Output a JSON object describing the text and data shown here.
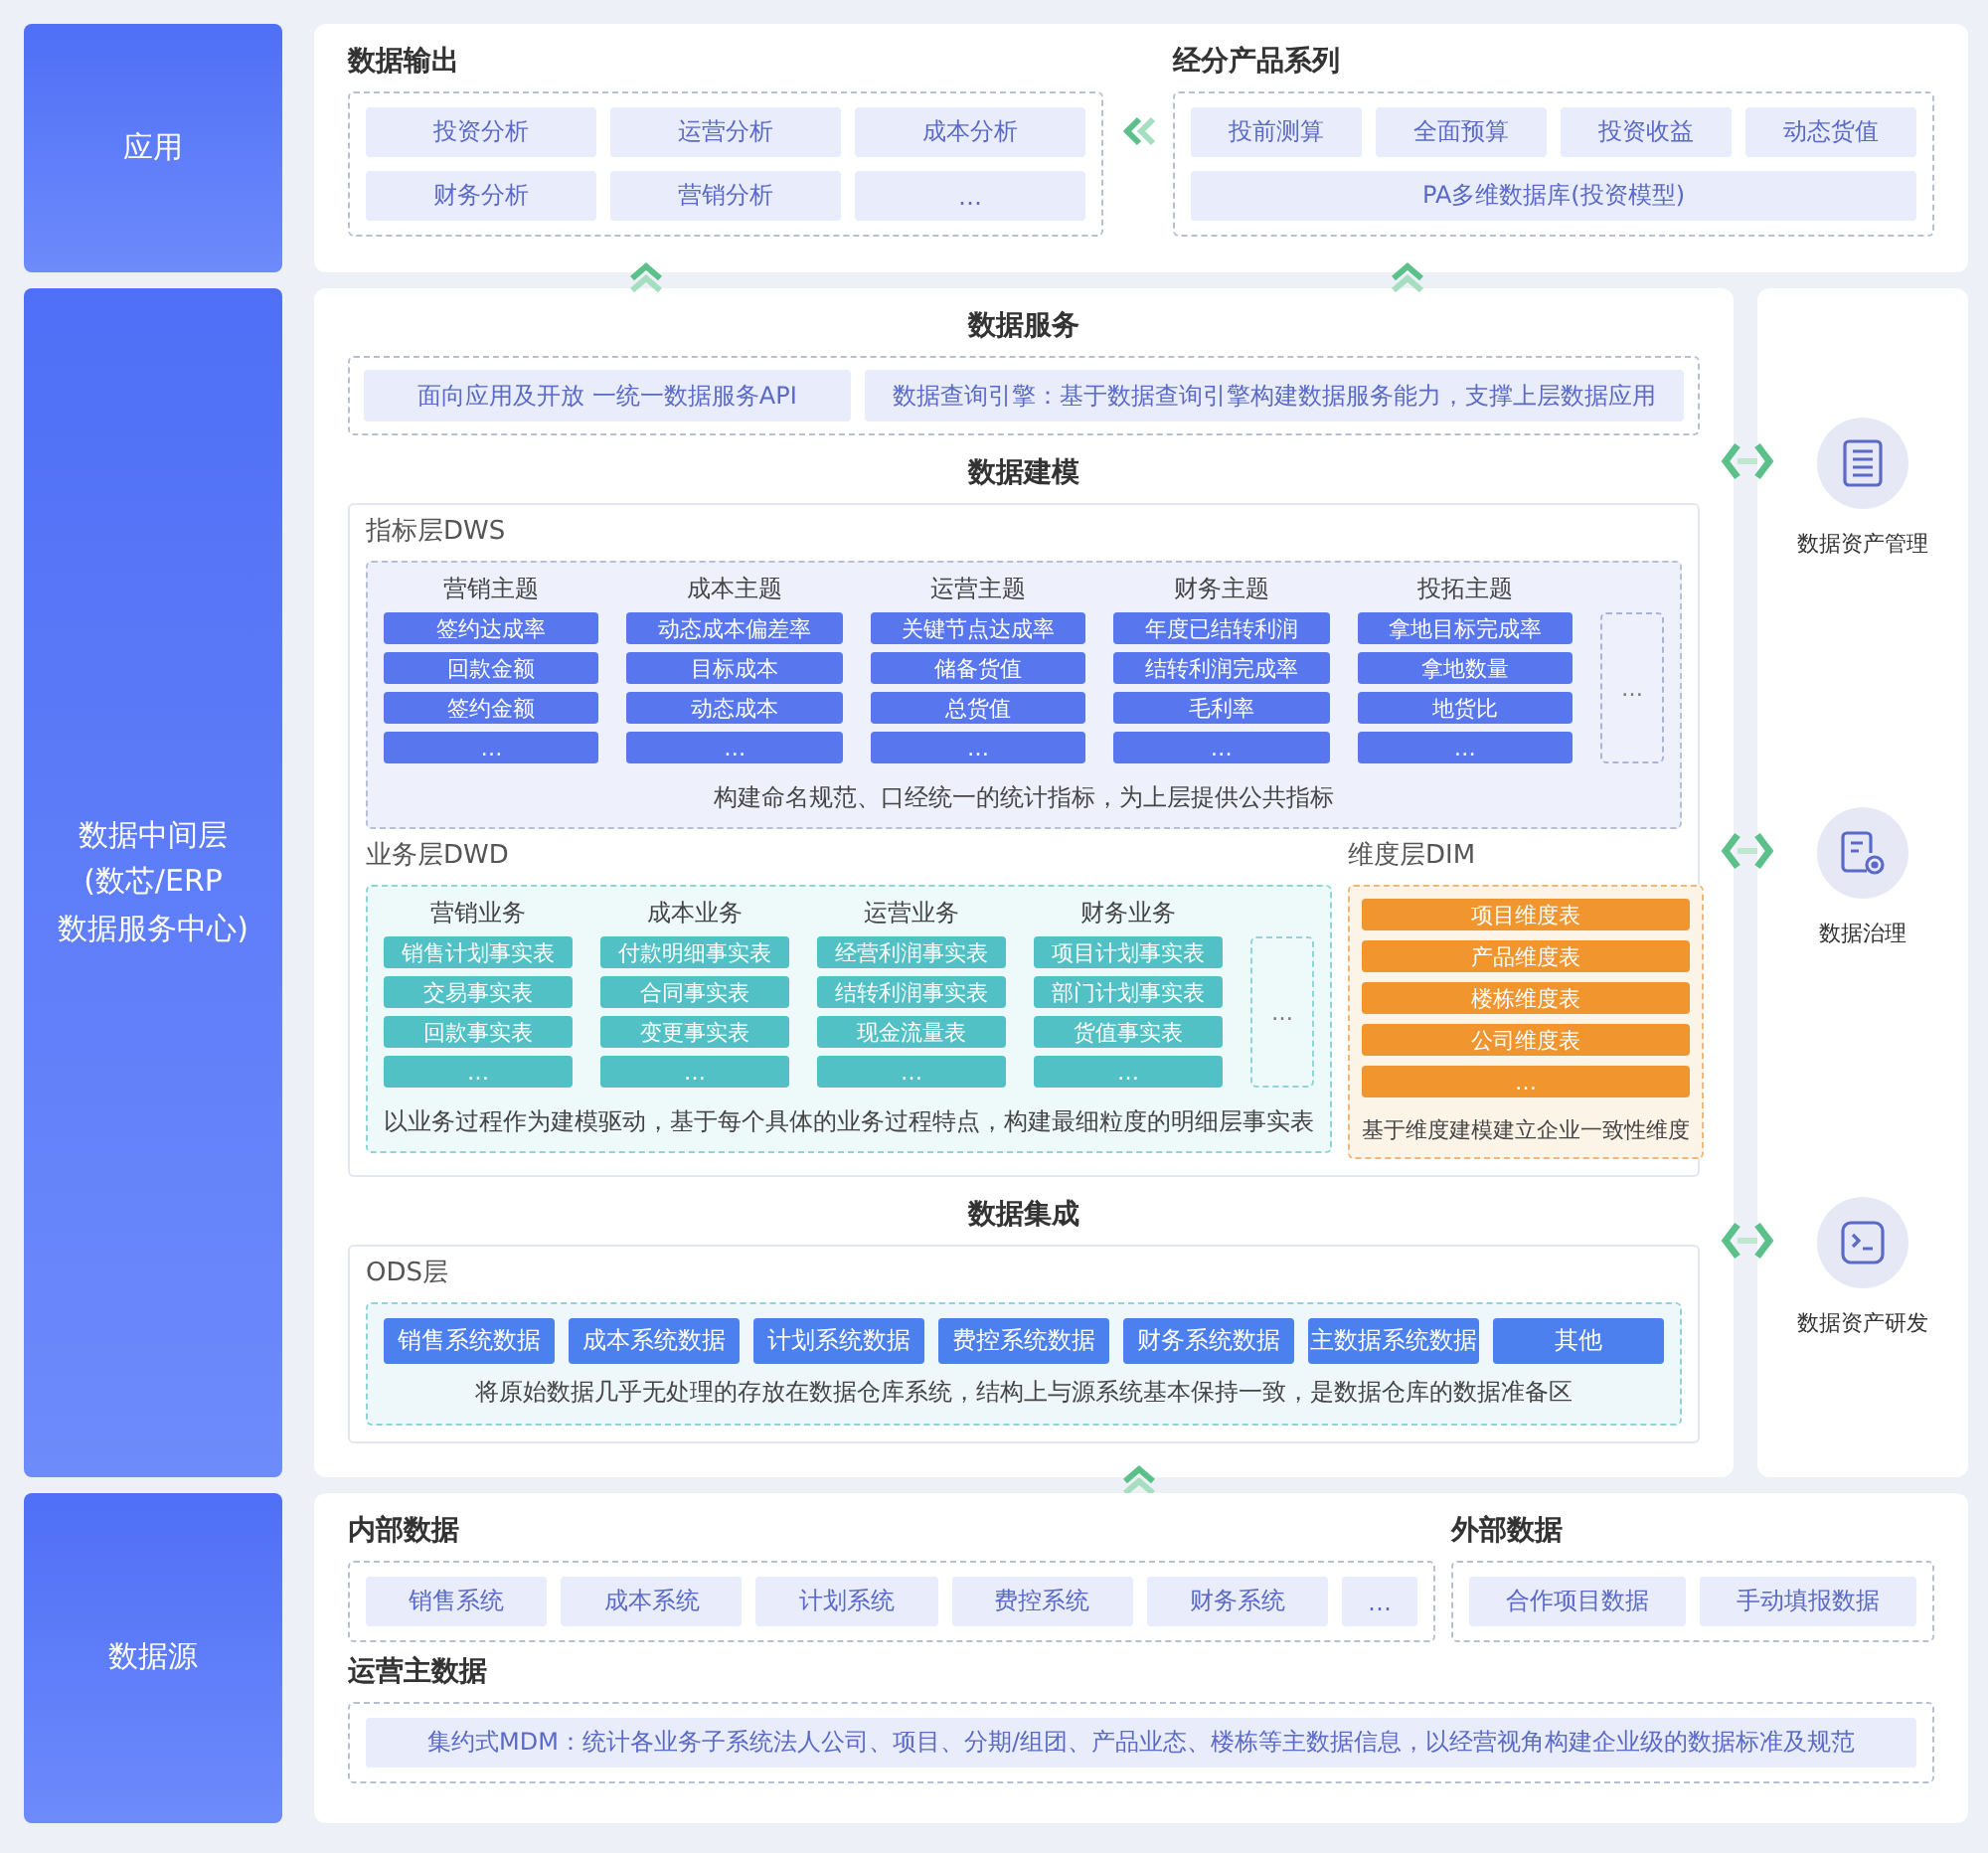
{
  "layers": [
    {
      "lines": [
        "应用"
      ]
    },
    {
      "lines": [
        "数据中间层",
        "(数芯/ERP",
        "数据服务中心)"
      ]
    },
    {
      "lines": [
        "数据源"
      ]
    }
  ],
  "application": {
    "data_output": {
      "title": "数据输出",
      "items": [
        "投资分析",
        "运营分析",
        "成本分析",
        "财务分析",
        "营销分析",
        "…"
      ]
    },
    "products": {
      "title": "经分产品系列",
      "items": [
        "投前测算",
        "全面预算",
        "投资收益",
        "动态货值"
      ],
      "base": "PA多维数据库(投资模型)"
    }
  },
  "middle": {
    "data_service": {
      "title": "数据服务",
      "items": [
        "面向应用及开放 一统一数据服务API",
        "数据查询引擎：基于数据查询引擎构建数据服务能力，支撑上层数据应用"
      ]
    },
    "modeling": {
      "title": "数据建模",
      "dws": {
        "title": "指标层DWS",
        "more": "…",
        "caption": "构建命名规范、口经统一的统计指标，为上层提供公共指标",
        "columns": [
          {
            "title": "营销主题",
            "items": [
              "签约达成率",
              "回款金额",
              "签约金额",
              "…"
            ]
          },
          {
            "title": "成本主题",
            "items": [
              "动态成本偏差率",
              "目标成本",
              "动态成本",
              "…"
            ]
          },
          {
            "title": "运营主题",
            "items": [
              "关键节点达成率",
              "储备货值",
              "总货值",
              "…"
            ]
          },
          {
            "title": "财务主题",
            "items": [
              "年度已结转利润",
              "结转利润完成率",
              "毛利率",
              "…"
            ]
          },
          {
            "title": "投拓主题",
            "items": [
              "拿地目标完成率",
              "拿地数量",
              "地货比",
              "…"
            ]
          }
        ]
      },
      "dwd": {
        "title": "业务层DWD",
        "more": "…",
        "caption": "以业务过程作为建模驱动，基于每个具体的业务过程特点，构建最细粒度的明细层事实表",
        "columns": [
          {
            "title": "营销业务",
            "items": [
              "销售计划事实表",
              "交易事实表",
              "回款事实表",
              "…"
            ]
          },
          {
            "title": "成本业务",
            "items": [
              "付款明细事实表",
              "合同事实表",
              "变更事实表",
              "…"
            ]
          },
          {
            "title": "运营业务",
            "items": [
              "经营利润事实表",
              "结转利润事实表",
              "现金流量表",
              "…"
            ]
          },
          {
            "title": "财务业务",
            "items": [
              "项目计划事实表",
              "部门计划事实表",
              "货值事实表",
              "…"
            ]
          }
        ]
      },
      "dim": {
        "title": "维度层DIM",
        "items": [
          "项目维度表",
          "产品维度表",
          "楼栋维度表",
          "公司维度表",
          "…"
        ],
        "caption": "基于维度建模建立企业一致性维度"
      }
    },
    "integration": {
      "title": "数据集成",
      "ods": {
        "title": "ODS层",
        "items": [
          "销售系统数据",
          "成本系统数据",
          "计划系统数据",
          "费控系统数据",
          "财务系统数据",
          "主数据系统数据",
          "其他"
        ],
        "caption": "将原始数据几乎无处理的存放在数据仓库系统，结构上与源系统基本保持一致，是数据仓库的数据准备区"
      }
    }
  },
  "services": [
    {
      "label": "数据资产管理"
    },
    {
      "label": "数据治理"
    },
    {
      "label": "数据资产研发"
    }
  ],
  "source": {
    "internal": {
      "title": "内部数据",
      "items": [
        "销售系统",
        "成本系统",
        "计划系统",
        "费控系统",
        "财务系统",
        "…"
      ]
    },
    "external": {
      "title": "外部数据",
      "items": [
        "合作项目数据",
        "手动填报数据"
      ]
    },
    "master": {
      "title": "运营主数据",
      "items": [
        "集约式MDM：统计各业务子系统法人公司、项目、分期/组团、产品业态、楼栋等主数据信息，以经营视角构建企业级的数据标准及规范"
      ]
    }
  }
}
